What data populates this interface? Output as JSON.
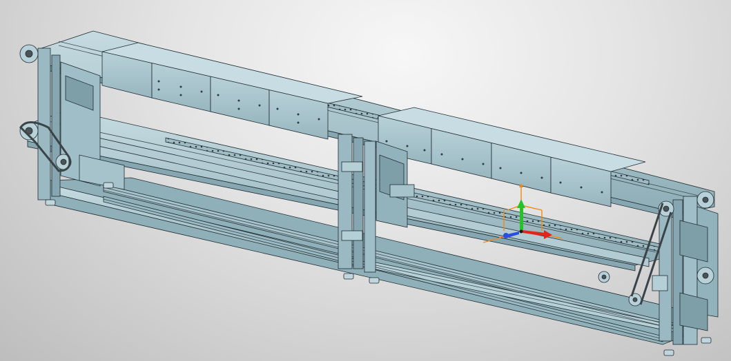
{
  "viewport": {
    "background_top": "#f7f7f7",
    "background_bottom": "#bdbdbd"
  },
  "model": {
    "face_color": "#a6c3cc",
    "face_dark": "#85a6b0",
    "face_light": "#c2d8de",
    "edge_color": "#1f2b30",
    "belt_color": "#4a5458"
  },
  "triad": {
    "x_axis_color": "#e0261d",
    "y_axis_color": "#27c227",
    "z_axis_color": "#2a4fe0",
    "handle_color": "#f08a12",
    "icons": [
      "move-triad-icon"
    ]
  }
}
